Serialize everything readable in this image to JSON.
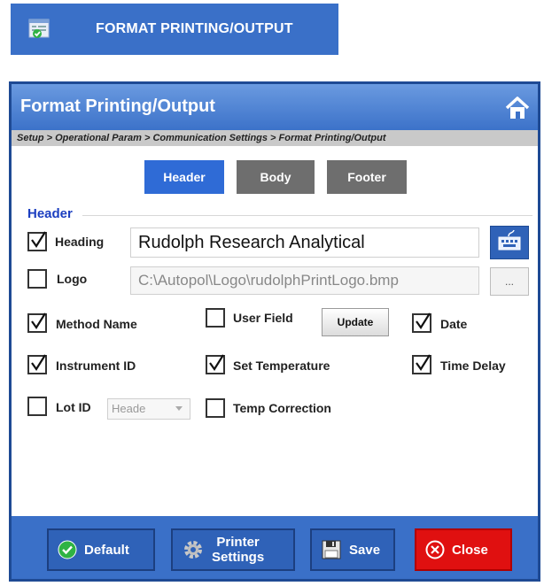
{
  "banner": {
    "title": "FORMAT PRINTING/OUTPUT"
  },
  "window": {
    "title": "Format Printing/Output",
    "breadcrumb": "Setup > Operational Param > Communication Settings > Format Printing/Output"
  },
  "tabs": [
    {
      "label": "Header",
      "active": true
    },
    {
      "label": "Body",
      "active": false
    },
    {
      "label": "Footer",
      "active": false
    }
  ],
  "header_group": {
    "label": "Header",
    "heading": {
      "label": "Heading",
      "checked": true,
      "value": "Rudolph Research Analytical"
    },
    "logo": {
      "label": "Logo",
      "checked": false,
      "value": "C:\\Autopol\\Logo\\rudolphPrintLogo.bmp",
      "browse_label": "..."
    },
    "method_name": {
      "label": "Method Name",
      "checked": true
    },
    "user_field": {
      "label": "User Field",
      "checked": false,
      "update_label": "Update"
    },
    "date": {
      "label": "Date",
      "checked": true
    },
    "instrument_id": {
      "label": "Instrument ID",
      "checked": true
    },
    "set_temperature": {
      "label": "Set Temperature",
      "checked": true
    },
    "time_delay": {
      "label": "Time Delay",
      "checked": true
    },
    "lot_id": {
      "label": "Lot ID",
      "checked": false,
      "select_value": "Heade"
    },
    "temp_correction": {
      "label": "Temp Correction",
      "checked": false
    }
  },
  "footer_buttons": {
    "default": "Default",
    "printer_settings_line1": "Printer",
    "printer_settings_line2": "Settings",
    "save": "Save",
    "close": "Close"
  },
  "colors": {
    "accent": "#3a70c8",
    "close": "#e01010",
    "header_label": "#1b3ec0"
  }
}
